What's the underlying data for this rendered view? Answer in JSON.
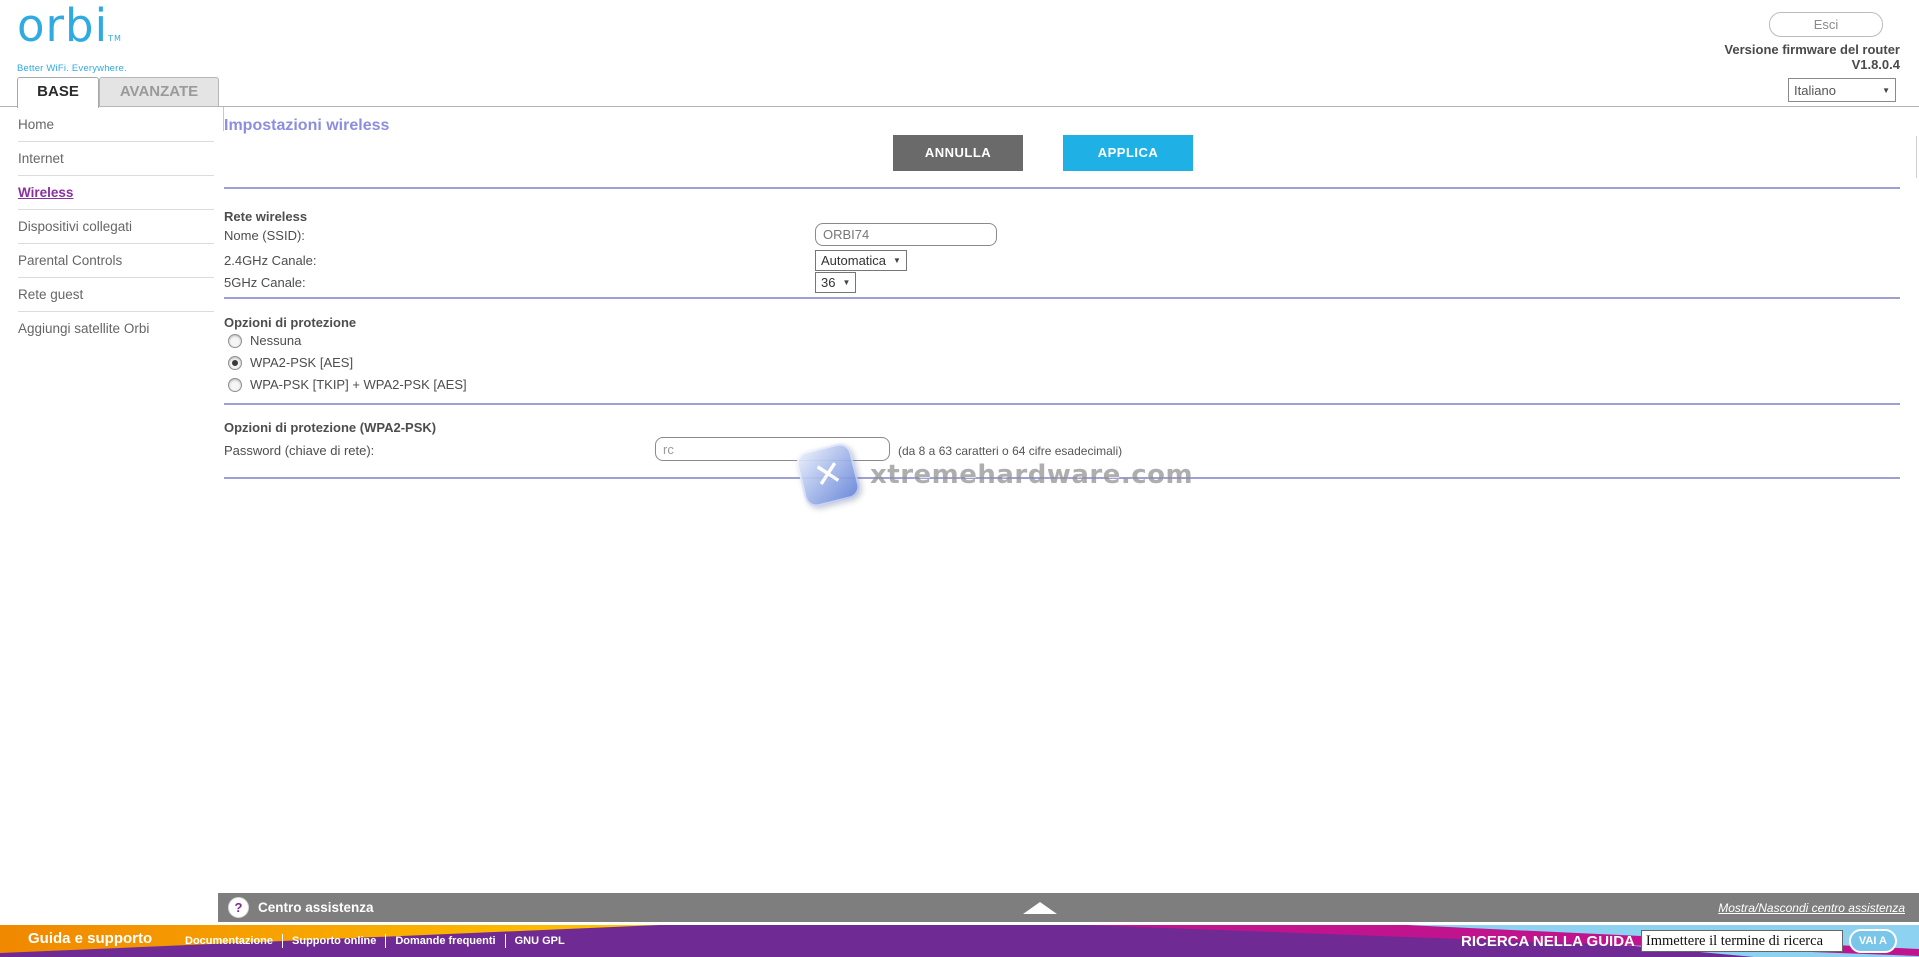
{
  "header": {
    "logo_text": "orbi",
    "logo_tm": "TM",
    "tagline": "Better WiFi. Everywhere.",
    "logout_label": "Esci",
    "firmware_label": "Versione firmware del router",
    "firmware_version": "V1.8.0.4",
    "language_selected": "Italiano"
  },
  "tabs": [
    {
      "label": "BASE",
      "active": true
    },
    {
      "label": "AVANZATE",
      "active": false
    }
  ],
  "sidebar": {
    "items": [
      {
        "label": "Home",
        "active": false
      },
      {
        "label": "Internet",
        "active": false
      },
      {
        "label": "Wireless",
        "active": true
      },
      {
        "label": "Dispositivi collegati",
        "active": false
      },
      {
        "label": "Parental Controls",
        "active": false
      },
      {
        "label": "Rete guest",
        "active": false
      },
      {
        "label": "Aggiungi satellite Orbi",
        "active": false
      }
    ]
  },
  "main": {
    "title": "Impostazioni wireless",
    "cancel_label": "ANNULLA",
    "apply_label": "APPLICA",
    "rete_wireless": {
      "section_title": "Rete wireless",
      "ssid_label": "Nome (SSID):",
      "ssid_value": "ORBI74",
      "ch24_label": "2.4GHz Canale:",
      "ch24_value": "Automatica",
      "ch5_label": "5GHz Canale:",
      "ch5_value": "36"
    },
    "protezione": {
      "section_title": "Opzioni di protezione",
      "options": [
        {
          "label": "Nessuna",
          "selected": false
        },
        {
          "label": "WPA2-PSK [AES]",
          "selected": true
        },
        {
          "label": "WPA-PSK [TKIP] + WPA2-PSK [AES]",
          "selected": false
        }
      ]
    },
    "wpa2": {
      "section_title": "Opzioni di protezione (WPA2-PSK)",
      "password_label": "Password (chiave di rete):",
      "password_value": "rc",
      "password_hint": "(da 8 a 63 caratteri o 64 cifre esadecimali)"
    }
  },
  "watermark": {
    "text": "xtremehardware.com",
    "x_glyph": "✕"
  },
  "assistance": {
    "title": "Centro assistenza",
    "help_glyph": "?",
    "toggle_label": "Mostra/Nascondi centro assistenza"
  },
  "footer": {
    "support_title": "Guida e supporto",
    "links": [
      "Documentazione",
      "Supporto online",
      "Domande frequenti",
      "GNU GPL"
    ],
    "search_label": "RICERCA NELLA GUIDA",
    "search_value": "Immettere il termine di ricerca",
    "go_label": "VAI A"
  },
  "icons": {
    "dropdown_arrow": "▼"
  },
  "colors": {
    "brand_cyan": "#2fabe1",
    "apply_blue": "#1fb1e6",
    "heading_purple": "#8d8ddf",
    "divider_purple": "#9f9fd8",
    "sidebar_active_purple": "#8a2fa0",
    "assist_gray": "#7e7e7e",
    "footer_purple": "#6f2b93",
    "footer_magenta": "#c2138f",
    "footer_lightblue": "#8ed2f1",
    "footer_orange": "#f39200"
  }
}
